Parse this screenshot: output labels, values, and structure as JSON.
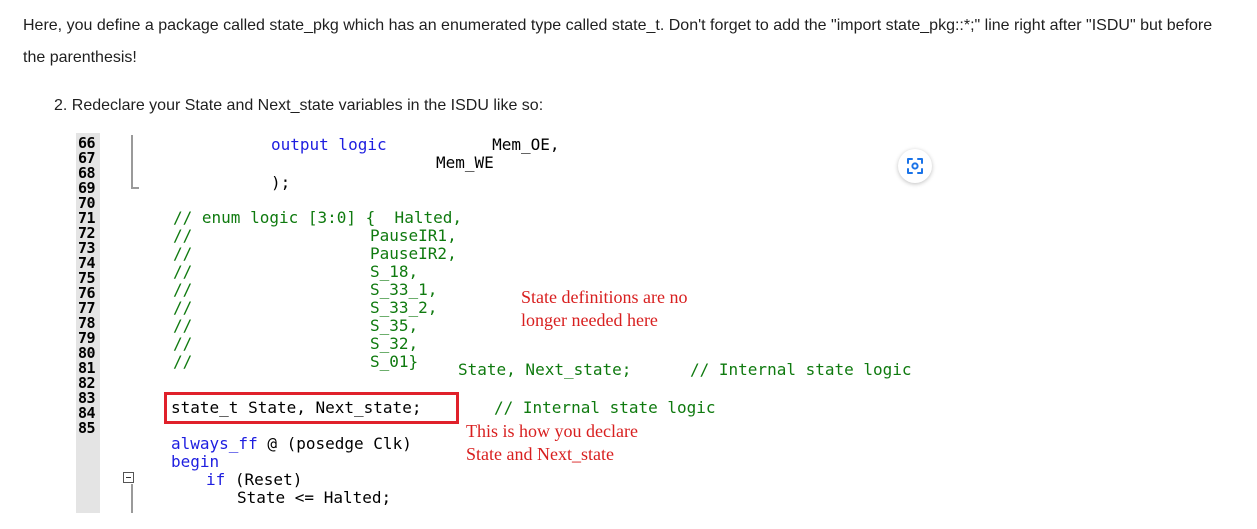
{
  "intro_paragraph": "Here, you define a package called state_pkg which has an enumerated type called state_t. Don't forget to add the \"import state_pkg::*;\" line right after \"ISDU\" but before the parenthesis!",
  "step_item": "2. Redeclare your State and Next_state variables in the ISDU like so:",
  "line_numbers": [
    "66",
    "67",
    "68",
    "69",
    "70",
    "71",
    "72",
    "73",
    "74",
    "75",
    "76",
    "77",
    "78",
    "79",
    "80",
    "81",
    "82",
    "83",
    "84",
    "85"
  ],
  "code": {
    "l66_kw": "output logic",
    "l66_rest": "        Mem_OE,",
    "l67": "Mem_WE",
    "l68": ");",
    "l70_cm": "// enum logic [3:0] {  Halted,",
    "l71": "PauseIR1,",
    "l72": "PauseIR2,",
    "l73": "S_18,",
    "l74": "S_33_1,",
    "l75": "S_33_2,",
    "l76": "S_35,",
    "l77": "S_32,",
    "l78": "S_01}",
    "l78_vars": "State, Next_state;",
    "l78_comment": "// Internal state logic",
    "slash": "//",
    "l80_decl": "state_t State, Next_state;",
    "l80_comment": "// Internal state logic",
    "l82_kw": "always_ff",
    "l82_rest": " @ (posedge Clk)",
    "l83": "begin",
    "l84_kw": "if",
    "l84_rest": " (Reset)",
    "l85": "State <= Halted;"
  },
  "annotations": {
    "note1_line1": "State definitions are no",
    "note1_line2": "longer needed here",
    "note2_line1": "This is how you declare",
    "note2_line2": "State and Next_state"
  },
  "colors": {
    "keyword": "#1e1ee0",
    "comment": "#0f7a0f",
    "annotation": "#d81f1f",
    "highlight_box": "#e0202a"
  },
  "icons": {
    "lens": "lens-search-icon"
  }
}
